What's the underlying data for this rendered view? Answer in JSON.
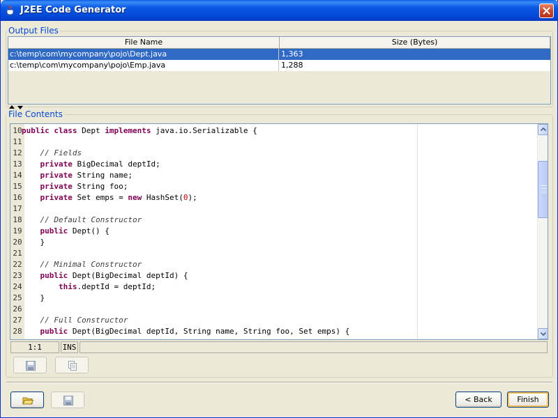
{
  "window": {
    "title": "J2EE Code Generator",
    "icons": {
      "app": "java-coffee-cup-icon",
      "close": "close-icon"
    }
  },
  "output_files": {
    "legend": "Output Files",
    "columns": [
      "File Name",
      "Size (Bytes)"
    ],
    "rows": [
      {
        "file": "c:\\temp\\com\\mycompany\\pojo\\Dept.java",
        "size": "1,363",
        "selected": true
      },
      {
        "file": "c:\\temp\\com\\mycompany\\pojo\\Emp.java",
        "size": "1,288",
        "selected": false
      }
    ]
  },
  "file_contents": {
    "legend": "File Contents",
    "lines": [
      {
        "num": "10",
        "tokens": [
          [
            "kw",
            "public"
          ],
          [
            "t",
            " "
          ],
          [
            "kw",
            "class"
          ],
          [
            "t",
            " Dept "
          ],
          [
            "kw",
            "implements"
          ],
          [
            "t",
            " java.io.Serializable {"
          ]
        ]
      },
      {
        "num": "11",
        "tokens": []
      },
      {
        "num": "12",
        "tokens": [
          [
            "t",
            "    "
          ],
          [
            "cm",
            "// Fields"
          ]
        ]
      },
      {
        "num": "13",
        "tokens": [
          [
            "t",
            "    "
          ],
          [
            "kw",
            "private"
          ],
          [
            "t",
            " BigDecimal deptId;"
          ]
        ]
      },
      {
        "num": "14",
        "tokens": [
          [
            "t",
            "    "
          ],
          [
            "kw",
            "private"
          ],
          [
            "t",
            " String name;"
          ]
        ]
      },
      {
        "num": "15",
        "tokens": [
          [
            "t",
            "    "
          ],
          [
            "kw",
            "private"
          ],
          [
            "t",
            " String foo;"
          ]
        ]
      },
      {
        "num": "16",
        "tokens": [
          [
            "t",
            "    "
          ],
          [
            "kw",
            "private"
          ],
          [
            "t",
            " Set emps = "
          ],
          [
            "kw",
            "new"
          ],
          [
            "t",
            " HashSet("
          ],
          [
            "nm",
            "0"
          ],
          [
            "t",
            ");"
          ]
        ]
      },
      {
        "num": "17",
        "tokens": []
      },
      {
        "num": "18",
        "tokens": [
          [
            "t",
            "    "
          ],
          [
            "cm",
            "// Default Constructor"
          ]
        ]
      },
      {
        "num": "19",
        "tokens": [
          [
            "t",
            "    "
          ],
          [
            "kw",
            "public"
          ],
          [
            "t",
            " Dept() {"
          ]
        ]
      },
      {
        "num": "20",
        "tokens": [
          [
            "t",
            "    }"
          ]
        ]
      },
      {
        "num": "21",
        "tokens": []
      },
      {
        "num": "22",
        "tokens": [
          [
            "t",
            "    "
          ],
          [
            "cm",
            "// Minimal Constructor"
          ]
        ]
      },
      {
        "num": "23",
        "tokens": [
          [
            "t",
            "    "
          ],
          [
            "kw",
            "public"
          ],
          [
            "t",
            " Dept(BigDecimal deptId) {"
          ]
        ]
      },
      {
        "num": "24",
        "tokens": [
          [
            "t",
            "        "
          ],
          [
            "kw",
            "this"
          ],
          [
            "t",
            ".deptId = deptId;"
          ]
        ]
      },
      {
        "num": "25",
        "tokens": [
          [
            "t",
            "    }"
          ]
        ]
      },
      {
        "num": "26",
        "tokens": []
      },
      {
        "num": "27",
        "tokens": [
          [
            "t",
            "    "
          ],
          [
            "cm",
            "// Full Constructor"
          ]
        ]
      },
      {
        "num": "28",
        "tokens": [
          [
            "t",
            "    "
          ],
          [
            "kw",
            "public"
          ],
          [
            "t",
            " Dept(BigDecimal deptId, String name, String foo, Set emps) {"
          ]
        ]
      }
    ],
    "status": {
      "position": "1:1",
      "mode": "INS",
      "message": ""
    },
    "toolbar": {
      "save_icon": "save-icon",
      "copy_icon": "copy-icon"
    }
  },
  "footer": {
    "open_icon": "open-folder-icon",
    "save_icon": "save-icon",
    "back_label": "< Back",
    "finish_label": "Finish"
  }
}
